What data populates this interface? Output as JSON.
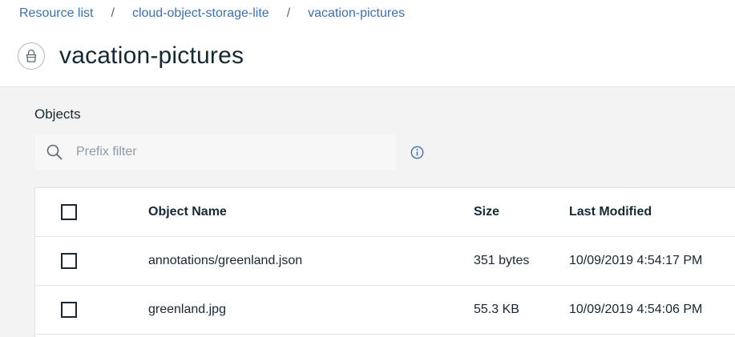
{
  "breadcrumb": {
    "items": [
      "Resource list",
      "cloud-object-storage-lite",
      "vacation-pictures"
    ],
    "separator": "/"
  },
  "page": {
    "title": "vacation-pictures",
    "icon": "bucket-icon"
  },
  "objects": {
    "section_label": "Objects",
    "search_placeholder": "Prefix filter",
    "search_value": "",
    "columns": [
      "Object Name",
      "Size",
      "Last Modified"
    ],
    "rows": [
      {
        "name": "annotations/greenland.json",
        "size": "351 bytes",
        "modified": "10/09/2019 4:54:17 PM"
      },
      {
        "name": "greenland.jpg",
        "size": "55.3 KB",
        "modified": "10/09/2019 4:54:06 PM"
      }
    ]
  },
  "colors": {
    "link": "#3d70b2",
    "text": "#152935",
    "background": "#f3f3f3"
  }
}
